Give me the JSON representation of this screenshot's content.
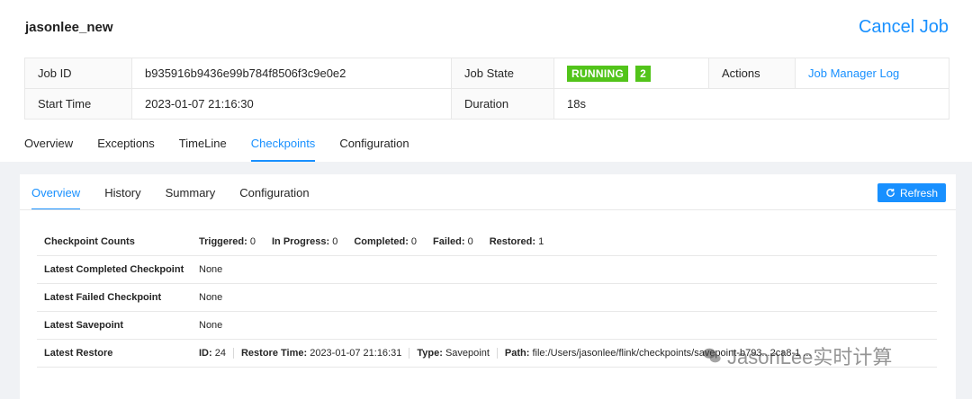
{
  "job": {
    "name": "jasonlee_new",
    "cancel_label": "Cancel Job"
  },
  "info": {
    "job_id_label": "Job ID",
    "job_id": "b935916b9436e99b784f8506f3c9e0e2",
    "job_state_label": "Job State",
    "job_state": "RUNNING",
    "running_count": "2",
    "actions_label": "Actions",
    "actions_link": "Job Manager Log",
    "start_time_label": "Start Time",
    "start_time": "2023-01-07 21:16:30",
    "duration_label": "Duration",
    "duration": "18s"
  },
  "job_tabs": [
    {
      "label": "Overview"
    },
    {
      "label": "Exceptions"
    },
    {
      "label": "TimeLine"
    },
    {
      "label": "Checkpoints"
    },
    {
      "label": "Configuration"
    }
  ],
  "card_tabs": [
    {
      "label": "Overview"
    },
    {
      "label": "History"
    },
    {
      "label": "Summary"
    },
    {
      "label": "Configuration"
    }
  ],
  "refresh_label": "Refresh",
  "stats": {
    "counts_label": "Checkpoint Counts",
    "triggered_label": "Triggered:",
    "triggered": "0",
    "in_progress_label": "In Progress:",
    "in_progress": "0",
    "completed_label": "Completed:",
    "completed": "0",
    "failed_label": "Failed:",
    "failed": "0",
    "restored_label": "Restored:",
    "restored": "1",
    "latest_completed_label": "Latest Completed Checkpoint",
    "latest_completed": "None",
    "latest_failed_label": "Latest Failed Checkpoint",
    "latest_failed": "None",
    "latest_savepoint_label": "Latest Savepoint",
    "latest_savepoint": "None",
    "latest_restore_label": "Latest Restore",
    "restore_id_label": "ID:",
    "restore_id": "24",
    "restore_time_label": "Restore Time:",
    "restore_time": "2023-01-07 21:16:31",
    "restore_type_label": "Type:",
    "restore_type": "Savepoint",
    "restore_path_label": "Path:",
    "restore_path": "file:/Users/jasonlee/flink/checkpoints/savepoint-b793...2ca8-1 ..."
  },
  "watermark": "JasonLee实时计算",
  "colors": {
    "accent": "#1890ff",
    "running": "#52c41a"
  }
}
